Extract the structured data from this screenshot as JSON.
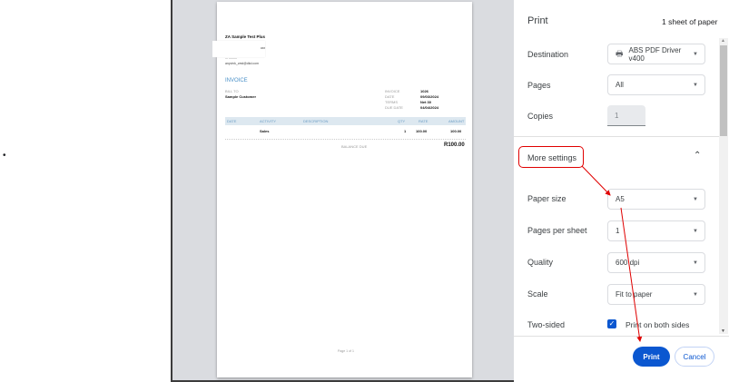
{
  "bullet": "•",
  "invoice": {
    "company": "ZA Sample Test Plus",
    "line2": "###",
    "line3": "--- ---------",
    "email": "anyvink_zest@dkd.com",
    "title": "INVOICE",
    "bill_to_label": "BILL TO",
    "customer": "Sample Customer",
    "meta": [
      {
        "label": "INVOICE",
        "value": "1026"
      },
      {
        "label": "DATE",
        "value": "09/03/2024"
      },
      {
        "label": "TERMS",
        "value": "Net 30"
      },
      {
        "label": "DUE DATE",
        "value": "04/04/2024"
      }
    ],
    "columns": {
      "date": "DATE",
      "activity": "ACTIVITY",
      "description": "DESCRIPTION",
      "qty": "QTY",
      "rate": "RATE",
      "amount": "AMOUNT"
    },
    "rows": [
      {
        "activity": "Sales",
        "qty": "1",
        "rate": "100.00",
        "amount": "100.00"
      }
    ],
    "balance_label": "BALANCE DUE",
    "balance_value": "R100.00",
    "page_footer": "Page 1 of 1"
  },
  "print": {
    "title": "Print",
    "sheets": "1 sheet of paper",
    "destination": {
      "label": "Destination",
      "value": "ABS PDF Driver v400"
    },
    "pages": {
      "label": "Pages",
      "value": "All"
    },
    "copies": {
      "label": "Copies",
      "value": "1"
    },
    "more_settings": "More settings",
    "paper_size": {
      "label": "Paper size",
      "value": "A5"
    },
    "pages_per_sheet": {
      "label": "Pages per sheet",
      "value": "1"
    },
    "quality": {
      "label": "Quality",
      "value": "600 dpi"
    },
    "scale": {
      "label": "Scale",
      "value": "Fit to paper"
    },
    "two_sided": {
      "label": "Two-sided",
      "option": "Print on both sides",
      "checked": true
    },
    "print_button": "Print",
    "cancel_button": "Cancel"
  },
  "colors": {
    "accent": "#0b57d0",
    "annotation": "#e00000",
    "invoice_blue": "#4a90c8"
  }
}
